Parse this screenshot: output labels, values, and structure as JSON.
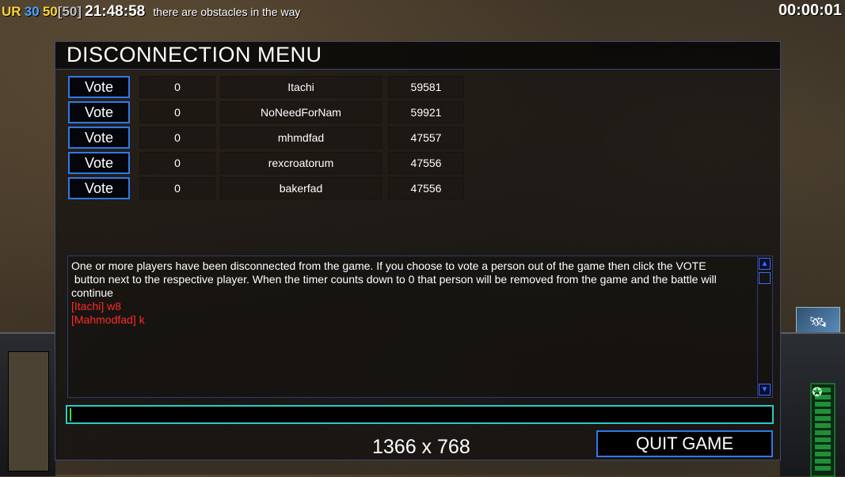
{
  "hud": {
    "prefix": "UR",
    "value1": "30",
    "value2": "50",
    "value3": "[50]",
    "time": "21:48:58",
    "message": "there are obstacles in the way",
    "clock": "00:00:01"
  },
  "dialog": {
    "title": "DISCONNECTION MENU",
    "players": [
      {
        "vote_label": "Vote",
        "votes": "0",
        "name": "Itachi",
        "value": "59581"
      },
      {
        "vote_label": "Vote",
        "votes": "0",
        "name": "NoNeedForNam",
        "value": "59921"
      },
      {
        "vote_label": "Vote",
        "votes": "0",
        "name": "mhmdfad",
        "value": "47557"
      },
      {
        "vote_label": "Vote",
        "votes": "0",
        "name": "rexcroatorum",
        "value": "47556"
      },
      {
        "vote_label": "Vote",
        "votes": "0",
        "name": "bakerfad",
        "value": "47556"
      }
    ],
    "chat": {
      "system_line1": "One or more players have been disconnected from the game. If you choose to vote a person out of the game then click the VOTE",
      "system_line2": " button next to the respective player. When the timer counts down to 0 that person will be removed from the game and the battle will",
      "system_line3": "continue",
      "msg1": "[Itachi] w8",
      "msg2": "[Mahmodfad] k"
    },
    "resolution": "1366 x 768",
    "quit_label": "QUIT GAME"
  },
  "colors": {
    "accent_blue": "#2f79e8",
    "chat_red": "#ff2a2a",
    "input_border": "#33c7c7"
  }
}
